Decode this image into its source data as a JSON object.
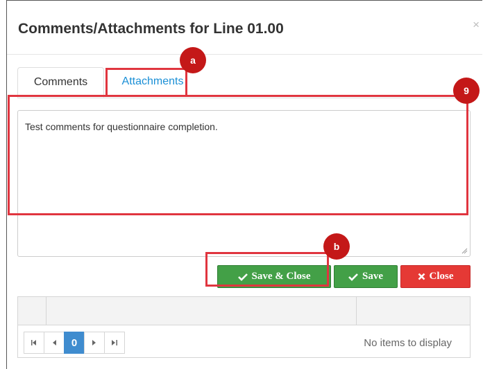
{
  "dialog": {
    "title": "Comments/Attachments for Line 01.00",
    "close_glyph": "×"
  },
  "tabs": [
    {
      "label": "Comments",
      "active": true
    },
    {
      "label": "Attachments",
      "active": false
    }
  ],
  "comment": {
    "value": "Test comments for questionnaire completion."
  },
  "buttons": {
    "save_close": "Save & Close",
    "save": "Save",
    "close": "Close"
  },
  "pager": {
    "current_page": "0",
    "status": "No items to display"
  },
  "annotations": {
    "a": "a",
    "b": "b",
    "nine": "9"
  },
  "colors": {
    "accent_link": "#1a8fd6",
    "success": "#43a047",
    "danger": "#e53935",
    "highlight": "#e0353f",
    "badge": "#c41818",
    "pager_active": "#3f8ccf"
  },
  "icons": {
    "close": "close-icon",
    "check": "check-icon",
    "x_mark": "x-mark-icon",
    "first": "first-page-icon",
    "prev": "prev-page-icon",
    "next": "next-page-icon",
    "last": "last-page-icon",
    "resize": "resize-grip-icon"
  }
}
